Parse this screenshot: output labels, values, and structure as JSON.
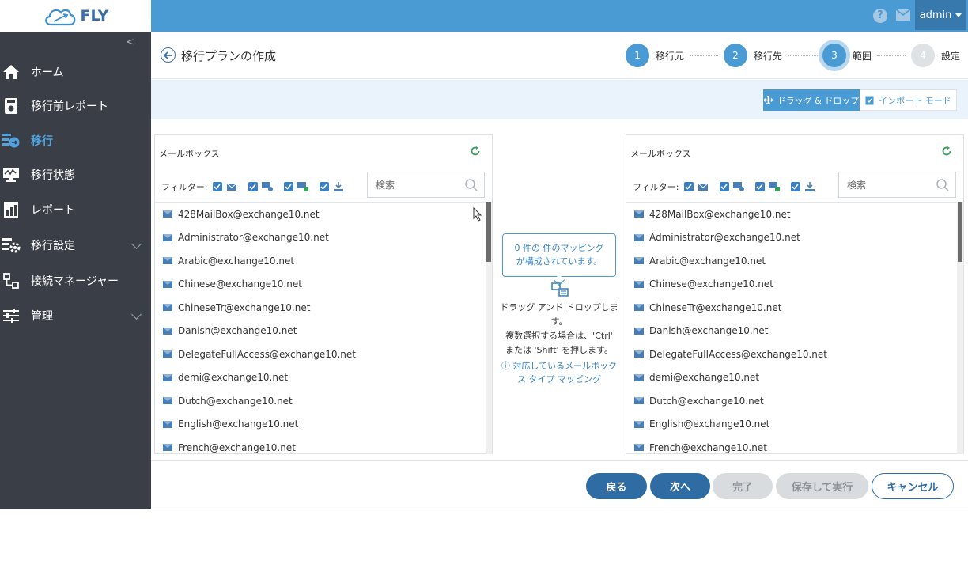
{
  "app": {
    "logo_text": "FLY",
    "user_name": "admin"
  },
  "colors": {
    "primary": "#4a9ad4",
    "sidebar_bg": "#3a3f47",
    "active_nav": "#4fa3e0",
    "dark_button": "#2f6ca3"
  },
  "sidebar": {
    "items": [
      {
        "label": "ホーム",
        "icon": "home-icon"
      },
      {
        "label": "移行前レポート",
        "icon": "pre-report-icon"
      },
      {
        "label": "移行",
        "icon": "migration-icon",
        "active": true
      },
      {
        "label": "移行状態",
        "icon": "monitor-icon"
      },
      {
        "label": "レポート",
        "icon": "report-chart-icon"
      },
      {
        "label": "移行設定",
        "icon": "settings-gears-icon",
        "expandable": true
      },
      {
        "label": "接続マネージャー",
        "icon": "connection-icon"
      },
      {
        "label": "管理",
        "icon": "sliders-icon",
        "expandable": true
      }
    ]
  },
  "header": {
    "title": "移行プランの作成",
    "steps": [
      {
        "num": "1",
        "label": "移行元"
      },
      {
        "num": "2",
        "label": "移行先"
      },
      {
        "num": "3",
        "label": "範囲"
      },
      {
        "num": "4",
        "label": "設定"
      }
    ]
  },
  "modes": {
    "drag_drop": "ドラッグ & ドロップ",
    "import": "インポート モード"
  },
  "left_panel": {
    "title": "メールボックス",
    "filter_label": "フィルター:",
    "search_placeholder": "検索",
    "items": [
      "428MailBox@exchange10.net",
      "Administrator@exchange10.net",
      "Arabic@exchange10.net",
      "Chinese@exchange10.net",
      "ChineseTr@exchange10.net",
      "Danish@exchange10.net",
      "DelegateFullAccess@exchange10.net",
      "demi@exchange10.net",
      "Dutch@exchange10.net",
      "English@exchange10.net",
      "French@exchange10.net"
    ]
  },
  "right_panel": {
    "title": "メールボックス",
    "filter_label": "フィルター:",
    "search_placeholder": "検索",
    "items": [
      "428MailBox@exchange10.net",
      "Administrator@exchange10.net",
      "Arabic@exchange10.net",
      "Chinese@exchange10.net",
      "ChineseTr@exchange10.net",
      "Danish@exchange10.net",
      "DelegateFullAccess@exchange10.net",
      "demi@exchange10.net",
      "Dutch@exchange10.net",
      "English@exchange10.net",
      "French@exchange10.net"
    ]
  },
  "middle": {
    "mapping_status": "0 件の 件のマッピング が構成されています。",
    "instructions_line1": "ドラッグ アンド ドロップします。",
    "instructions_line2": "複数選択する場合は、'Ctrl'",
    "instructions_line3": "または 'Shift' を押します。",
    "supported_link": "対応しているメールボックス タイプ マッピング"
  },
  "footer": {
    "back": "戻る",
    "next": "次へ",
    "finish": "完了",
    "save_run": "保存して実行",
    "cancel": "キャンセル"
  }
}
